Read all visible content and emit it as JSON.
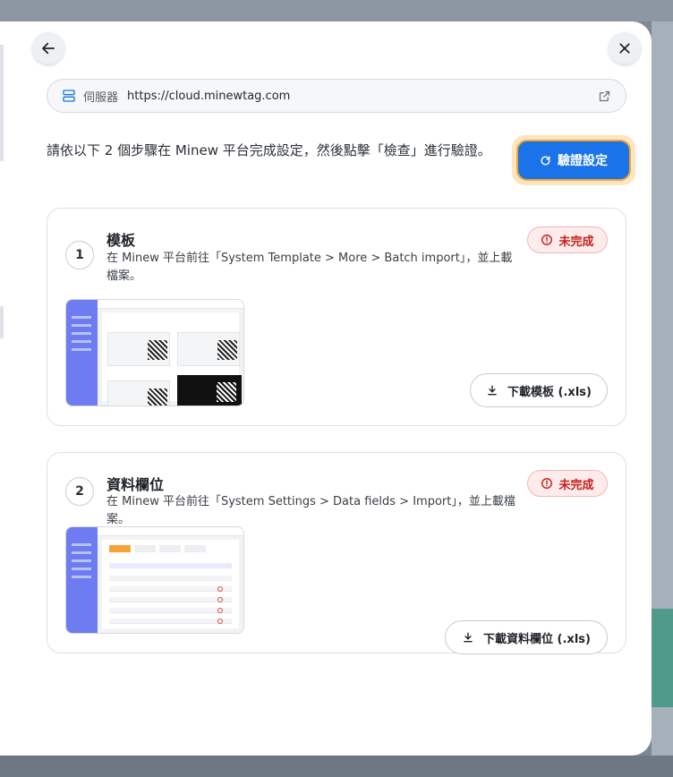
{
  "server": {
    "label": "伺服器",
    "url": "https://cloud.minewtag.com"
  },
  "intro": {
    "text": "請依以下 2 個步驟在 Minew 平台完成設定，然後點擊「檢查」進行驗證。"
  },
  "verify": {
    "label": "驗證設定"
  },
  "steps": [
    {
      "number": "1",
      "title": "模板",
      "description": "在 Minew 平台前往「System Template > More > Batch import」，並上載檔案。",
      "status": "未完成",
      "download_label": "下載模板 (.xls)"
    },
    {
      "number": "2",
      "title": "資料欄位",
      "description": "在 Minew 平台前往「System Settings > Data fields > Import」，並上載檔案。",
      "status": "未完成",
      "download_label": "下載資料欄位 (.xls)"
    }
  ],
  "colors": {
    "primary": "#1a73e8",
    "highlight": "#f2a531",
    "error": "#c5221f"
  },
  "icons": {
    "back": "arrow-left-icon",
    "close": "close-icon",
    "server": "server-icon",
    "external": "external-link-icon",
    "refresh": "refresh-icon",
    "alert": "alert-circle-icon",
    "download": "download-icon"
  }
}
